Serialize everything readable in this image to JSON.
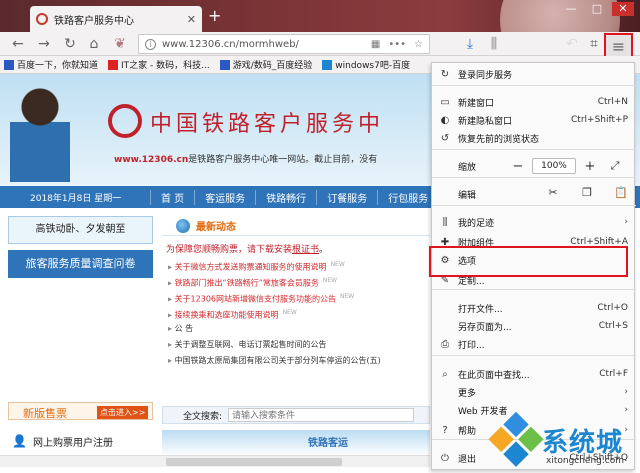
{
  "browser": {
    "tab_title": "铁路客户服务中心",
    "tab_close": "✕",
    "new_tab": "+",
    "address": "www.12306.cn/mormhweb/",
    "window_controls": [
      "—",
      "□",
      "✕"
    ]
  },
  "bookmarks": [
    {
      "icon": "paw-icon",
      "color": "#2b59c3",
      "label": "百度一下，你就知道"
    },
    {
      "icon": "it-icon",
      "color": "#d22",
      "label": "IT之家 - 数码，科技..."
    },
    {
      "icon": "paw-icon",
      "color": "#2b59c3",
      "label": "游戏/数码_百度经验"
    },
    {
      "icon": "win-icon",
      "color": "#1c86d0",
      "label": "windows7吧-百度"
    }
  ],
  "site": {
    "name": "中国铁路客户服务中",
    "slogan_url": "www.12306.cn",
    "slogan_text": "是铁路客户服务中心唯一网站。截止目前，没有",
    "date": "2018年1月8日 星期一",
    "nav": [
      "首 页",
      "客运服务",
      "铁路畅行",
      "订餐服务",
      "行包服务"
    ],
    "left_boxes": [
      "高铁动卧、夕发朝至",
      "旅客服务质量调查问卷"
    ],
    "sale_title": "新版售票",
    "sale_button": "点击进入>>",
    "register": "网上购票用户注册",
    "news_title": "最新动态",
    "notice_prefix": "为保障您顺畅购票，请下载安装",
    "notice_link": "根证书",
    "notice_suffix": "。",
    "news_items": [
      {
        "text": "关于微信方式发送购票通知服务的使用说明",
        "new": "NEW",
        "red": true
      },
      {
        "text": "铁路部门推出“铁路畅行”常旅客会员服务",
        "new": "NEW",
        "red": true
      },
      {
        "text": "关于12306网站新增微信支付服务功能的公告",
        "new": "NEW",
        "red": true
      },
      {
        "text": "接续换乘和选座功能使用说明",
        "new": "NEW",
        "red": true
      },
      {
        "text": "公 告",
        "new": "",
        "red": false
      },
      {
        "text": "关于调整互联网、电话订票起售时间的公告",
        "new": "",
        "red": false
      },
      {
        "text": "中国铁路太原局集团有限公司关于部分列车停运的公告(五)",
        "new": "",
        "red": false
      }
    ],
    "search_label": "全文搜索:",
    "search_placeholder": "请输入搜索条件",
    "train_caption": "铁路客运"
  },
  "menu": {
    "items": [
      {
        "icon": "sync-icon",
        "glyph": "↻",
        "label": "登录同步服务",
        "shortcut": "",
        "arrow": ""
      },
      {
        "icon": "window-icon",
        "glyph": "▭",
        "label": "新建窗口",
        "shortcut": "Ctrl+N",
        "arrow": ""
      },
      {
        "icon": "private-icon",
        "glyph": "◐",
        "label": "新建隐私窗口",
        "shortcut": "Ctrl+Shift+P",
        "arrow": ""
      },
      {
        "icon": "restore-icon",
        "glyph": "↺",
        "label": "恢复先前的浏览状态",
        "shortcut": "",
        "arrow": ""
      },
      {
        "icon": "library-icon",
        "glyph": "⫼",
        "label": "我的足迹",
        "shortcut": "",
        "arrow": "›"
      },
      {
        "icon": "addons-icon",
        "glyph": "✚",
        "label": "附加组件",
        "shortcut": "Ctrl+Shift+A",
        "arrow": ""
      },
      {
        "icon": "gear-icon",
        "glyph": "⚙",
        "label": "选项",
        "shortcut": "",
        "arrow": ""
      },
      {
        "icon": "customize-icon",
        "glyph": "✎",
        "label": "定制...",
        "shortcut": "",
        "arrow": ""
      },
      {
        "icon": "open-file-icon",
        "glyph": "",
        "label": "打开文件...",
        "shortcut": "Ctrl+O",
        "arrow": ""
      },
      {
        "icon": "save-icon",
        "glyph": "",
        "label": "另存页面为...",
        "shortcut": "Ctrl+S",
        "arrow": ""
      },
      {
        "icon": "print-icon",
        "glyph": "⎙",
        "label": "打印...",
        "shortcut": "",
        "arrow": ""
      },
      {
        "icon": "search-icon",
        "glyph": "⌕",
        "label": "在此页面中查找...",
        "shortcut": "Ctrl+F",
        "arrow": ""
      },
      {
        "icon": "more-icon",
        "glyph": "",
        "label": "更多",
        "shortcut": "",
        "arrow": "›"
      },
      {
        "icon": "dev-icon",
        "glyph": "",
        "label": "Web 开发者",
        "shortcut": "",
        "arrow": "›"
      },
      {
        "icon": "help-icon",
        "glyph": "?",
        "label": "帮助",
        "shortcut": "",
        "arrow": "›"
      },
      {
        "icon": "quit-icon",
        "glyph": "⏻",
        "label": "退出",
        "shortcut": "Ctrl+Shift+Q",
        "arrow": ""
      }
    ],
    "zoom_label": "缩放",
    "zoom_value": "100%",
    "edit_label": "编辑"
  },
  "watermark": {
    "big": "系统城",
    "small": "xitongcheng.com"
  },
  "colors": {
    "accent": "#2f73b8",
    "brand_red": "#c0212b",
    "highlight": "#e0141e"
  }
}
